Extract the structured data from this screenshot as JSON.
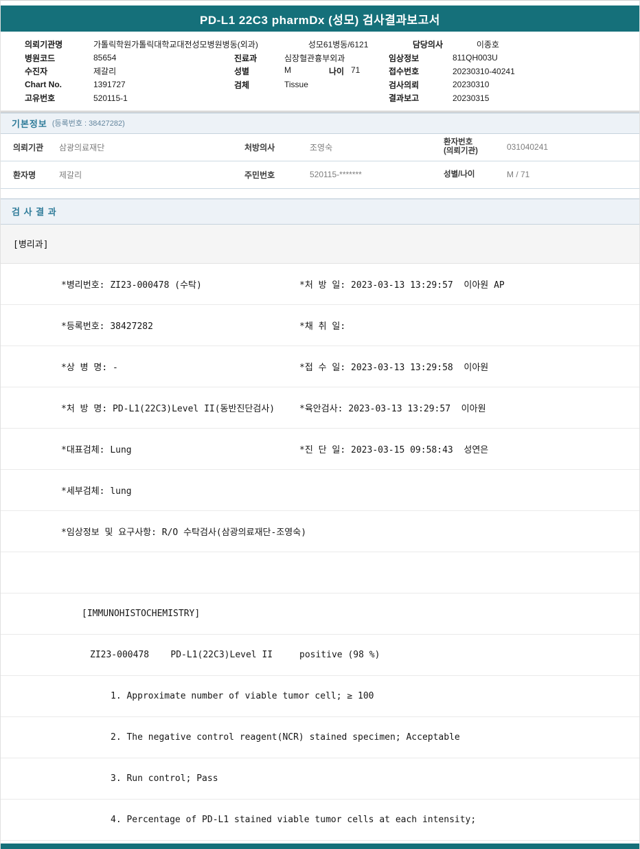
{
  "theme": {
    "header_bar_color": "#15707a",
    "section_title_color": "#2e7b99",
    "section_header_bg": "#edf2f7"
  },
  "report": {
    "title": "PD-L1 22C3 pharmDx (성모) 검사결과보고서"
  },
  "patient_header": {
    "rows": [
      {
        "l1": "의뢰기관명",
        "v1": "가톨릭학원가톨릭대학교대전성모병원병동(외과)",
        "l2": "",
        "v2": "성모61병동/6121",
        "l3": "담당의사",
        "v3": "이종호"
      },
      {
        "l1": "병원코드",
        "v1": "85654",
        "l2": "진료과",
        "v2": "심장혈관흉부외과",
        "l3": "임상정보",
        "v3": "811QH003U"
      },
      {
        "l1": "수진자",
        "v1": "제갈리",
        "l2": "성별",
        "v2": "M",
        "l2b": "나이",
        "v2b": "71",
        "l3": "접수번호",
        "v3": "20230310-40241"
      },
      {
        "l1": "Chart No.",
        "v1": "1391727",
        "l2": "검체",
        "v2": "Tissue",
        "l3": "검사의뢰",
        "v3": "20230310"
      },
      {
        "l1": "고유번호",
        "v1": "520115-1",
        "l2": "",
        "v2": "",
        "l3": "결과보고",
        "v3": "20230315"
      }
    ]
  },
  "basic_info": {
    "title": "기본정보",
    "subtitle": "(등록번호 : 38427282)",
    "table": {
      "rows": [
        {
          "c1l": "의뢰기관",
          "c1v": "삼광의료재단",
          "c2l": "처방의사",
          "c2v": "조영숙",
          "c3l": "환자번호\n(의뢰기관)",
          "c3v": "031040241"
        },
        {
          "c1l": "환자명",
          "c1v": "제갈리",
          "c2l": "주민번호",
          "c2v": "520115-*******",
          "c3l": "성별/나이",
          "c3v": "M / 71"
        }
      ]
    }
  },
  "results": {
    "title": "검 사 결 과",
    "dept": "[병리과]",
    "rows": [
      {
        "left": "*병리번호: ZI23-000478 (수탁)",
        "right": "*처 방 일: 2023-03-13 13:29:57  이아원 AP"
      },
      {
        "left": "*등록번호: 38427282",
        "right": "*채 취 일:"
      },
      {
        "left": "*상 병 명: -",
        "right": "*접 수 일: 2023-03-13 13:29:58  이아원"
      },
      {
        "left": "*처 방 명: PD-L1(22C3)Level II(동반진단검사)",
        "right": "*육안검사: 2023-03-13 13:29:57  이아원"
      },
      {
        "left": "*대표검체: Lung",
        "right": "*진 단 일: 2023-03-15 09:58:43  성연은"
      },
      {
        "left": "*세부검체: lung",
        "right": ""
      },
      {
        "left": "*임상정보 및 요구사항: R/O 수탁검사(삼광의료재단-조영숙)",
        "right": ""
      },
      {
        "left": "",
        "right": ""
      },
      {
        "left": "[IMMUNOHISTOCHEMISTRY]",
        "right": ""
      },
      {
        "left": "ZI23-000478    PD-L1(22C3)Level II",
        "right": "positive (98 %)"
      },
      {
        "left": "1. Approximate number of viable tumor cell; ≥ 100",
        "right": ""
      },
      {
        "left": "2. The negative control reagent(NCR) stained specimen; Acceptable",
        "right": ""
      },
      {
        "left": "3. Run control; Pass",
        "right": ""
      },
      {
        "left": "4. Percentage of PD-L1 stained viable tumor cells at each intensity;",
        "right": ""
      }
    ]
  }
}
